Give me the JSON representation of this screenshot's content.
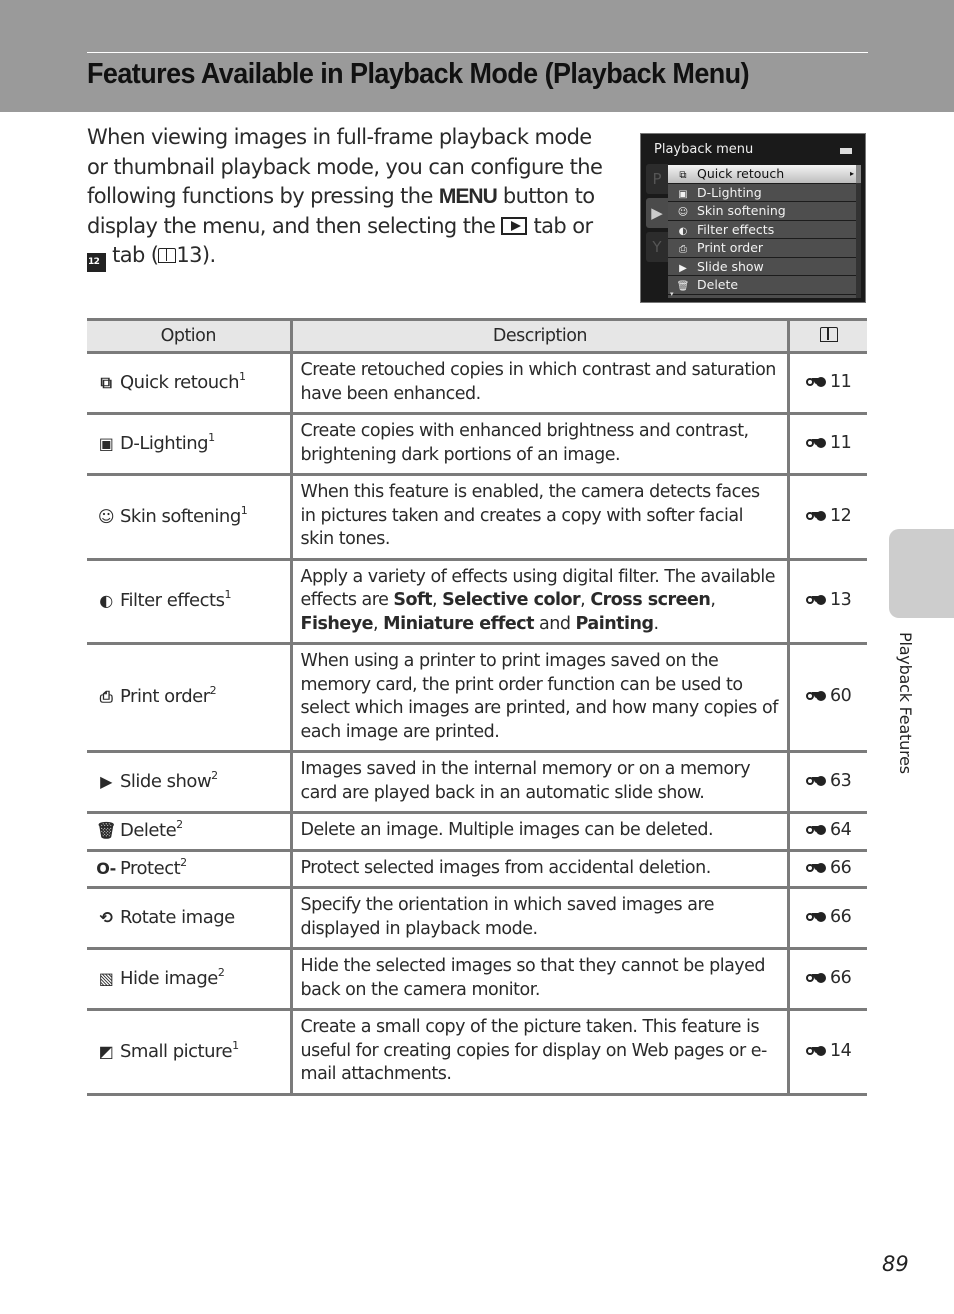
{
  "header": {
    "title": "Features Available in Playback Mode (Playback Menu)"
  },
  "intro": {
    "part1": "When viewing images in full-frame playback mode or thumbnail playback mode, you can configure the following functions by pressing the ",
    "menu_button": "MENU",
    "part2": " button to display the menu, and then selecting the ",
    "play_tab_icon": "playback-tab-icon",
    "part3": " tab or ",
    "thumb_tab_icon": "list-by-date-tab-icon",
    "thumb_tab_text": "12",
    "part4": " tab (",
    "ref_page": "13",
    "part5": ")."
  },
  "camera_menu": {
    "title": "Playback menu",
    "tabs": [
      {
        "label": "P",
        "icon": "shooting-tab-icon"
      },
      {
        "label": "▶",
        "icon": "playback-tab-icon"
      },
      {
        "label": "Y",
        "icon": "setup-tab-icon"
      }
    ],
    "items": [
      {
        "label": "Quick retouch",
        "icon": "quick-retouch-icon",
        "glyph": "⧉",
        "selected": true
      },
      {
        "label": "D-Lighting",
        "icon": "d-lighting-icon",
        "glyph": "▣"
      },
      {
        "label": "Skin softening",
        "icon": "skin-softening-icon",
        "glyph": "☺"
      },
      {
        "label": "Filter effects",
        "icon": "filter-effects-icon",
        "glyph": "◐"
      },
      {
        "label": "Print order",
        "icon": "print-order-icon",
        "glyph": "⎙"
      },
      {
        "label": "Slide show",
        "icon": "slide-show-icon",
        "glyph": "▶"
      },
      {
        "label": "Delete",
        "icon": "delete-icon",
        "glyph": "🗑"
      }
    ],
    "more_arrow": "▾",
    "submenu_arrow": "▸"
  },
  "table": {
    "headers": {
      "option": "Option",
      "description": "Description",
      "reference_icon": "book-icon"
    },
    "rows": [
      {
        "icon": "quick-retouch-icon",
        "glyph": "⧉",
        "option": "Quick retouch",
        "footnote": "1",
        "description": [
          {
            "t": "Create retouched copies in which contrast and saturation have been enhanced."
          }
        ],
        "ref": "11"
      },
      {
        "icon": "d-lighting-icon",
        "glyph": "▣",
        "option": "D-Lighting",
        "footnote": "1",
        "description": [
          {
            "t": "Create copies with enhanced brightness and contrast, brightening dark portions of an image."
          }
        ],
        "ref": "11"
      },
      {
        "icon": "skin-softening-icon",
        "glyph": "☺",
        "option": "Skin softening",
        "footnote": "1",
        "description": [
          {
            "t": "When this feature is enabled, the camera detects faces in pictures taken and creates a copy with softer facial skin tones."
          }
        ],
        "ref": "12"
      },
      {
        "icon": "filter-effects-icon",
        "glyph": "◐",
        "option": "Filter effects",
        "footnote": "1",
        "description": [
          {
            "t": "Apply a variety of effects using digital filter. The available effects are "
          },
          {
            "t": "Soft",
            "b": true
          },
          {
            "t": ", "
          },
          {
            "t": "Selective color",
            "b": true
          },
          {
            "t": ", "
          },
          {
            "t": "Cross screen",
            "b": true
          },
          {
            "t": ", "
          },
          {
            "t": "Fisheye",
            "b": true
          },
          {
            "t": ", "
          },
          {
            "t": "Miniature effect",
            "b": true
          },
          {
            "t": " and "
          },
          {
            "t": "Painting",
            "b": true
          },
          {
            "t": "."
          }
        ],
        "ref": "13"
      },
      {
        "icon": "print-order-icon",
        "glyph": "⎙",
        "option": "Print order",
        "footnote": "2",
        "description": [
          {
            "t": "When using a printer to print images saved on the memory card, the print order function can be used to select which images are printed, and how many copies of each image are printed."
          }
        ],
        "ref": "60"
      },
      {
        "icon": "slide-show-icon",
        "glyph": "▶",
        "option": "Slide show",
        "footnote": "2",
        "description": [
          {
            "t": "Images saved in the internal memory or on a memory card are played back in an automatic slide show."
          }
        ],
        "ref": "63"
      },
      {
        "icon": "delete-icon",
        "glyph": "🗑",
        "option": "Delete",
        "footnote": "2",
        "description": [
          {
            "t": "Delete an image. Multiple images can be deleted."
          }
        ],
        "ref": "64"
      },
      {
        "icon": "protect-icon",
        "glyph": "O-",
        "option": "Protect",
        "footnote": "2",
        "description": [
          {
            "t": "Protect selected images from accidental deletion."
          }
        ],
        "ref": "66"
      },
      {
        "icon": "rotate-image-icon",
        "glyph": "⟲",
        "option": "Rotate image",
        "footnote": "",
        "description": [
          {
            "t": "Specify the orientation in which saved images are displayed in playback mode."
          }
        ],
        "ref": "66"
      },
      {
        "icon": "hide-image-icon",
        "glyph": "▧",
        "option": "Hide image",
        "footnote": "2",
        "description": [
          {
            "t": "Hide the selected images so that they cannot be played back on the camera monitor."
          }
        ],
        "ref": "66"
      },
      {
        "icon": "small-picture-icon",
        "glyph": "◩",
        "option": "Small picture",
        "footnote": "1",
        "description": [
          {
            "t": "Create a small copy of the picture taken. This feature is useful for creating copies for display on Web pages or e-mail attachments."
          }
        ],
        "ref": "14"
      }
    ]
  },
  "side_tab": {
    "label": "Playback Features"
  },
  "page_number": "89"
}
